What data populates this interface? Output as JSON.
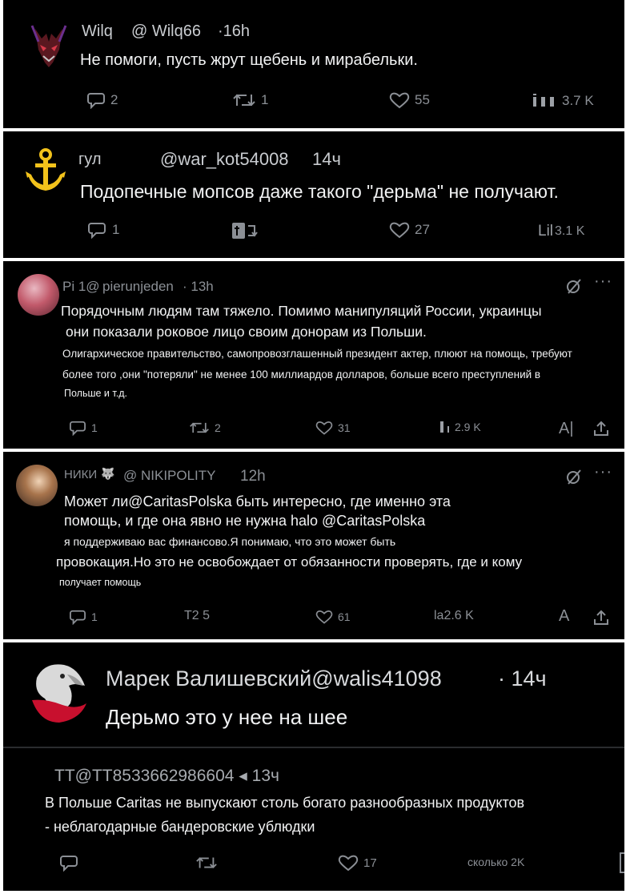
{
  "posts": [
    {
      "name": "Wilq",
      "handle": "@ Wilq66",
      "time": "·16h",
      "text": "Не помоги, пусть жрут щебень и мирабельки.",
      "replies": "2",
      "reposts": "1",
      "likes": "55",
      "views": "3.7 K"
    },
    {
      "name": "гул",
      "handle": "@war_kot54008",
      "time": "14ч",
      "text": "Подопечные мопсов даже такого \"дерьма\" не получают.",
      "replies": "1",
      "likes": "27",
      "views_prefix": "Lil",
      "views": "3.1 K"
    },
    {
      "name": "Pi 1@",
      "handle": "pierunjeden",
      "time": "· 13h",
      "text_lines": [
        "Порядочным людям там тяжело. Помимо манипуляций России, украинцы",
        "они показали роковое лицо своим донорам из Польши.",
        "Олигархическое правительство, самопровозглашенный президент актер, плюют на помощь, требуют",
        "более того ,они \"потеряли\" не менее 100 миллиардов долларов, больше всего преступлений в",
        "Польше и т.д."
      ],
      "replies": "1",
      "reposts": "2",
      "likes": "31",
      "views": "2.9 K",
      "translate": "A|"
    },
    {
      "name": "НИКИ",
      "handle": "@ NIKIPOLITY",
      "time": "12h",
      "text_lines": [
        "Может ли@CaritasPolska быть интересно, где именно эта",
        "помощь, и где она явно не нужна halo @CaritasPolska",
        "я поддерживаю вас финансово.Я понимаю, что это может быть",
        "провокация.Но это не освобождает от обязанности проверять, где и кому",
        "получает помощь"
      ],
      "replies": "1",
      "reposts": "T2 5",
      "likes": "61",
      "views": "la2.6 K",
      "translate": "A"
    },
    {
      "name": "Марек Валишевский@walis41098",
      "time": "· 14ч",
      "text": "Дерьмо это у нее на шее"
    },
    {
      "header": "TT@TT8533662986604 ◂ 13ч",
      "text_lines": [
        "В Польше Caritas не выпускают столь богато разнообразных продуктов",
        "- неблагодарные бандеровские ублюдки"
      ],
      "likes": "17",
      "views": "сколько 2K"
    }
  ],
  "icons": {
    "reply": "reply-icon",
    "repost": "repost-icon",
    "like": "heart-icon",
    "views": "views-icon",
    "share": "share-icon",
    "more": "more-icon",
    "grok": "grok-icon"
  },
  "colors": {
    "background": "#000000",
    "text": "#e7e9ea",
    "muted": "#8b8f95",
    "anchor": "#f2c21b"
  }
}
